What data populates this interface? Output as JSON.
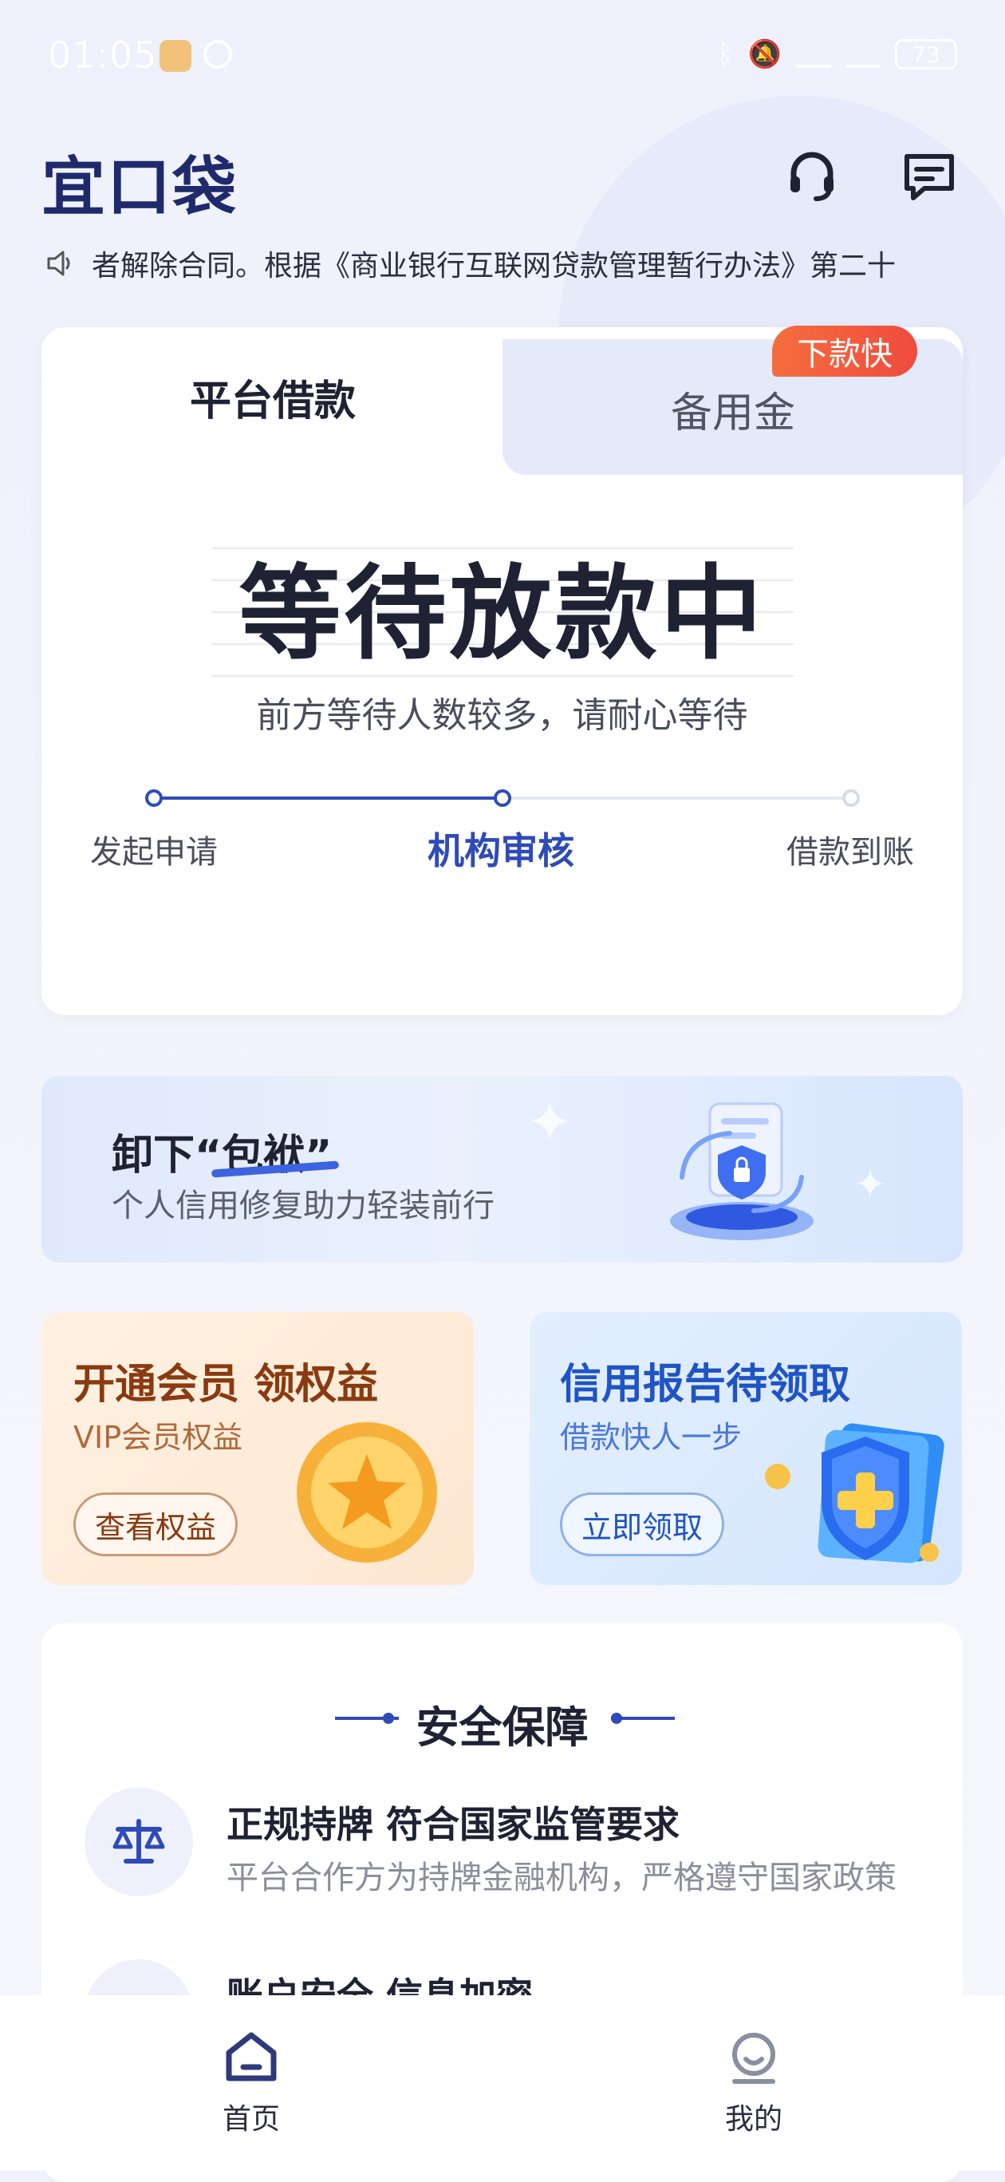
{
  "status_bar": {
    "time": "01:05",
    "battery": "73"
  },
  "header": {
    "logo": "宜口袋"
  },
  "notice": {
    "text": "者解除合同。根据《商业银行互联网贷款管理暂行办法》第二十"
  },
  "loan_card": {
    "tabs": [
      {
        "label": "平台借款"
      },
      {
        "label": "备用金"
      }
    ],
    "badge": "下款快",
    "status_title": "等待放款中",
    "status_sub": "前方等待人数较多，请耐心等待",
    "steps": [
      {
        "label": "发起申请"
      },
      {
        "label": "机构审核"
      },
      {
        "label": "借款到账"
      }
    ],
    "current_step_index": 1
  },
  "banner": {
    "title": "卸下“包袱”",
    "subtitle": "个人信用修复助力轻装前行"
  },
  "promos": [
    {
      "title": "开通会员 领权益",
      "subtitle": "VIP会员权益",
      "button": "查看权益"
    },
    {
      "title": "信用报告待领取",
      "subtitle": "借款快人一步",
      "button": "立即领取"
    }
  ],
  "security": {
    "title": "安全保障",
    "items": [
      {
        "title": "正规持牌 符合国家监管要求",
        "desc": "平台合作方为持牌金融机构，严格遵守国家政策"
      },
      {
        "title": "账户安全 信息加密",
        "desc": ""
      }
    ]
  },
  "bottom_nav": [
    {
      "label": "首页"
    },
    {
      "label": "我的"
    }
  ],
  "colors": {
    "accent": "#2e4bb8",
    "badge": "#f04b3f",
    "logo": "#1e2a6b"
  }
}
